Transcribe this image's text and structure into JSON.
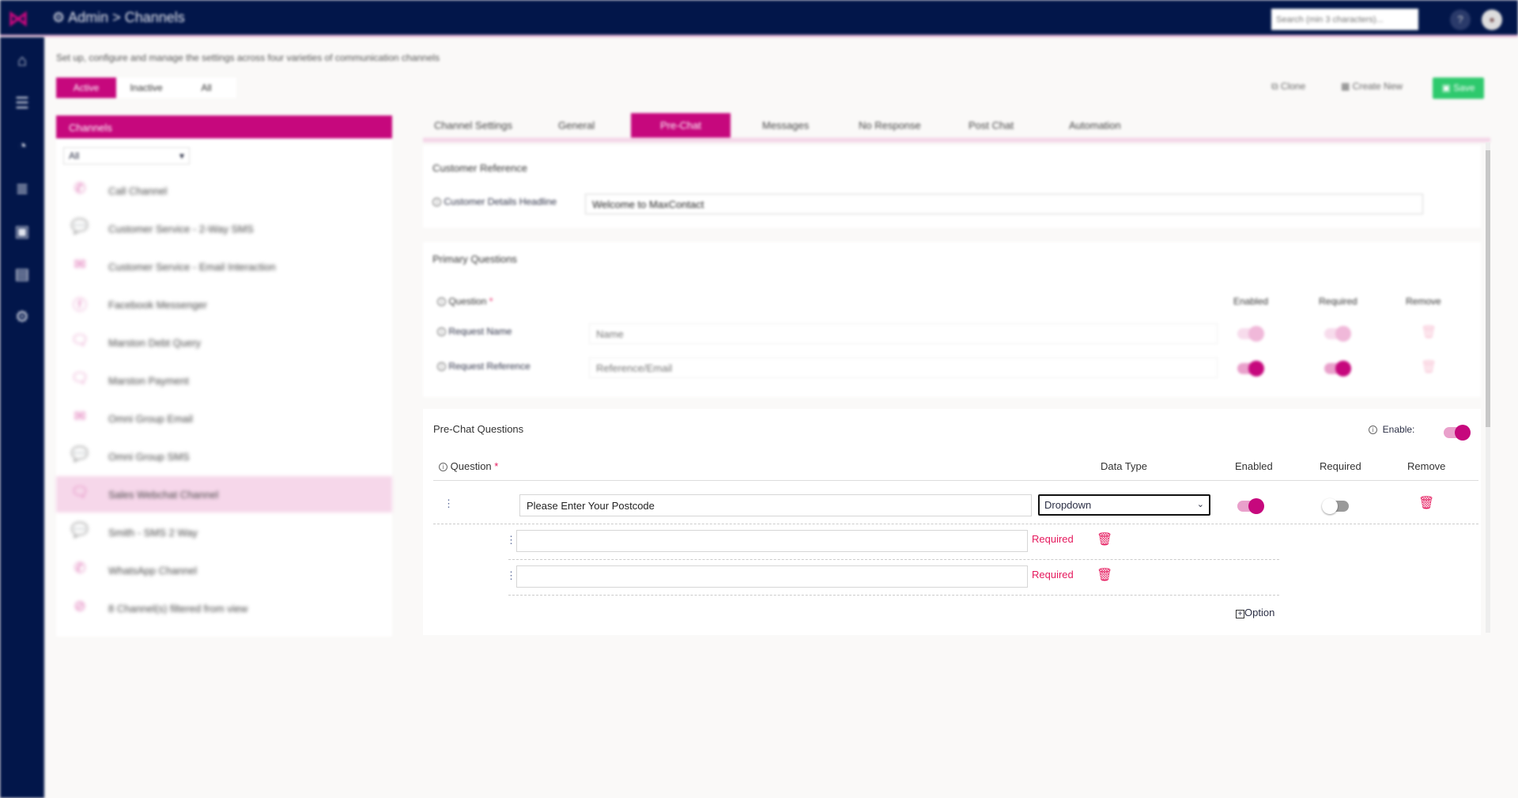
{
  "header": {
    "breadcrumb": "Admin > Channels",
    "search_placeholder": "Search (min 3 characters)..."
  },
  "page": {
    "subtitle": "Set up, configure and manage the settings across four varieties of communication channels",
    "filters": [
      "Active",
      "Inactive",
      "All"
    ],
    "active_filter": "Active",
    "actions": {
      "clone": "Clone",
      "create_new": "Create New",
      "save": "Save"
    }
  },
  "channels": {
    "title": "Channels",
    "select_value": "All",
    "items": [
      {
        "label": "Call Channel",
        "icon": "phone-icon"
      },
      {
        "label": "Customer Service - 2-Way SMS",
        "icon": "sms-icon"
      },
      {
        "label": "Customer Service - Email Interaction",
        "icon": "email-icon"
      },
      {
        "label": "Facebook Messenger",
        "icon": "facebook-icon"
      },
      {
        "label": "Marston Debt Query",
        "icon": "webchat-icon"
      },
      {
        "label": "Marston Payment",
        "icon": "webchat-icon"
      },
      {
        "label": "Omni Group Email",
        "icon": "email-icon"
      },
      {
        "label": "Omni Group SMS",
        "icon": "sms-icon"
      },
      {
        "label": "Sales Webchat Channel",
        "icon": "webchat-icon",
        "selected": true
      },
      {
        "label": "Smith - SMS 2 Way",
        "icon": "sms-icon"
      },
      {
        "label": "WhatsApp Channel",
        "icon": "whatsapp-icon"
      },
      {
        "label": "8  Channel(s) filtered from view",
        "icon": "filter-icon"
      }
    ]
  },
  "tabs": [
    "Channel Settings",
    "General",
    "Pre-Chat",
    "Messages",
    "No Response",
    "Post Chat",
    "Automation"
  ],
  "active_tab": "Pre-Chat",
  "customer_reference": {
    "title": "Customer Reference",
    "field_label": "Customer Details Headline",
    "field_value": "Welcome to MaxContact"
  },
  "primary_questions": {
    "title": "Primary Questions",
    "headers": {
      "question": "Question",
      "enabled": "Enabled",
      "required": "Required",
      "remove": "Remove"
    },
    "rows": [
      {
        "label": "Request Name",
        "placeholder": "Name",
        "enabled": false,
        "required": false
      },
      {
        "label": "Request Reference",
        "placeholder": "Reference/Email",
        "enabled": true,
        "required": true
      }
    ]
  },
  "prechat": {
    "title": "Pre-Chat Questions",
    "enable_label": "Enable:",
    "enabled": true,
    "headers": {
      "question": "Question",
      "data_type": "Data Type",
      "enabled": "Enabled",
      "required": "Required",
      "remove": "Remove"
    },
    "question": {
      "value": "Please Enter Your Postcode",
      "data_type": "Dropdown",
      "enabled": true,
      "required": false
    },
    "options": [
      {
        "value": "",
        "status": "Required"
      },
      {
        "value": "",
        "status": "Required"
      }
    ],
    "add_option": "Option"
  },
  "colors": {
    "brand": "#c6087d",
    "nav": "#02164a",
    "save": "#2ec96d",
    "danger": "#e5195d"
  }
}
